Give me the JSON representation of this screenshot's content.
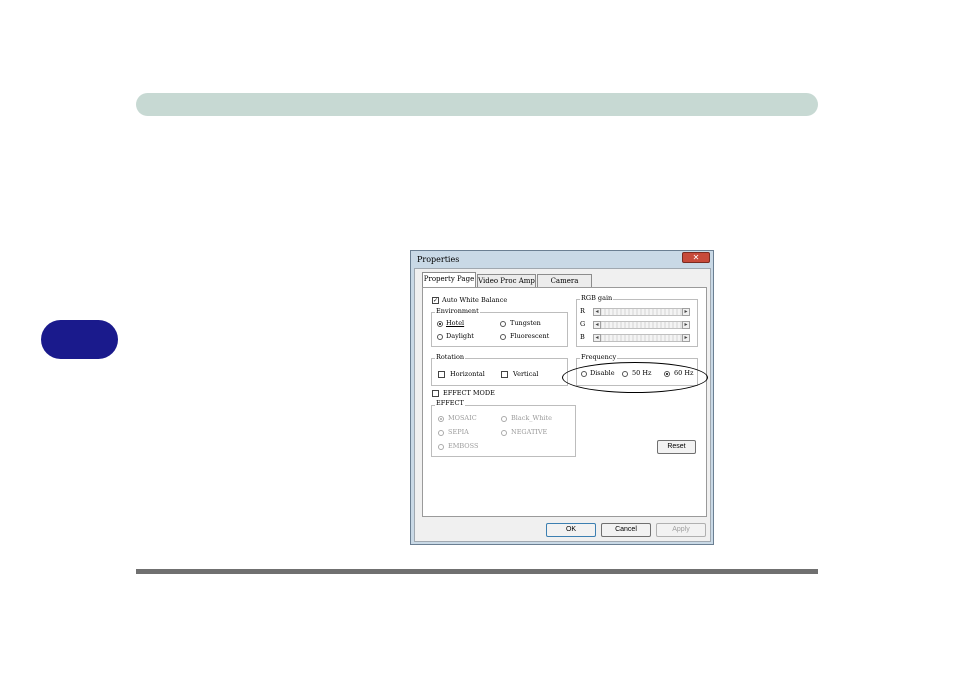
{
  "dialog": {
    "title": "Properties",
    "close_icon": "close-icon",
    "tabs": [
      {
        "label": "Property Page",
        "active": true
      },
      {
        "label": "Video Proc Amp",
        "active": false
      },
      {
        "label": "Camera Control",
        "active": false
      }
    ],
    "auto_white_balance": {
      "label": "Auto White Balance",
      "checked": true
    },
    "environment": {
      "label": "Environment",
      "options": [
        {
          "label": "Hotel",
          "selected": true
        },
        {
          "label": "Tungsten",
          "selected": false
        },
        {
          "label": "Daylight",
          "selected": false
        },
        {
          "label": "Fluorescent",
          "selected": false
        }
      ]
    },
    "rgb_gain": {
      "label": "RGB gain",
      "channels": [
        "R",
        "G",
        "B"
      ]
    },
    "rotation": {
      "label": "Rotation",
      "horizontal": {
        "label": "Horizontal",
        "checked": false
      },
      "vertical": {
        "label": "Vertical",
        "checked": false
      }
    },
    "frequency": {
      "label": "Frequency",
      "options": [
        {
          "label": "Disable",
          "selected": false
        },
        {
          "label": "50 Hz",
          "selected": false
        },
        {
          "label": "60 Hz",
          "selected": true
        }
      ]
    },
    "effect_mode": {
      "label": "EFFECT MODE",
      "checked": false
    },
    "effect": {
      "label": "EFFECT",
      "options": [
        {
          "label": "MOSAIC",
          "selected": true
        },
        {
          "label": "Black_White",
          "selected": false
        },
        {
          "label": "SEPIA",
          "selected": false
        },
        {
          "label": "NEGATIVE",
          "selected": false
        },
        {
          "label": "EMBOSS",
          "selected": false
        }
      ]
    },
    "reset_label": "Reset",
    "ok_label": "OK",
    "cancel_label": "Cancel",
    "apply_label": "Apply"
  }
}
